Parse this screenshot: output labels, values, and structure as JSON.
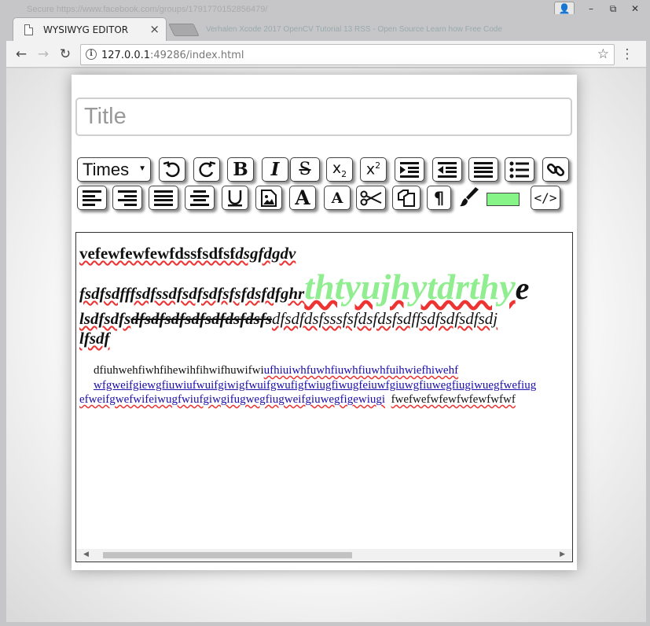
{
  "browser": {
    "ghost_titlebar_text": "Secure   https://www.facebook.com/groups/1791770152856479/",
    "tab_title": "WYSIWYG EDITOR",
    "tab_close": "×",
    "blurred_tabs_text": "Verhalen   Xcode 2017   OpenCV Tutorial 13   RSS - Open Source   Learn how Free Code",
    "url_host": "127.0.0.1",
    "url_path": ":49286/index.html",
    "window_controls": [
      "user-icon",
      "minimize",
      "restore",
      "close"
    ]
  },
  "editor": {
    "title_placeholder": "Title",
    "font_select_value": "Times",
    "toolbar_row1": [
      "undo-icon",
      "redo-icon",
      "bold-icon",
      "italic-icon",
      "strikethrough-icon",
      "subscript-icon",
      "superscript-icon",
      "indent-icon",
      "outdent-icon",
      "ordered-list-icon",
      "unordered-list-icon",
      "link-icon"
    ],
    "toolbar_row2": [
      "align-left-icon",
      "align-right-icon",
      "justify-icon",
      "align-center-icon",
      "underline-icon",
      "insert-image-icon",
      "font-size-increase-icon",
      "font-size-decrease-icon",
      "cut-icon",
      "copy-icon",
      "paragraph-icon",
      "paint-brush-icon",
      "html-source-icon"
    ],
    "color_swatch": "#86f486",
    "content": {
      "line1_bold": "vefewfewfewfdssfsdfsf",
      "line1_italic": "dsgfdgdv",
      "line2_a": "fsdfsdfffsdfssdfsdfsdfsfsfdsfdfghr",
      "line2_green": "thtyujhytdrthy",
      "line2_big": "e",
      "line3_a": "lsdfsdfs",
      "line3_strike": "dfsdfsdfsdfsdfdsfdsfs",
      "line3_b": "dfsdfdsfsssfsfdsfdsfsdffsdfsdfsdfsdj",
      "line4": "lfsdf",
      "para_plain": "dfiuhwehfiwhfihewihfihwifhuwifwi",
      "para_link1": "ufhiuiwhfuwhfiuwhfiuwhfuihwiefhiwehf",
      "para_link2": "wfgweifgiewgfiuwiufwuifgiwigfwuifgwufigfwiugfiwugfeiuwfgiuwgfiuwegfiugiwuegfwefiug",
      "para_link3": "efweifgwefwifeiwugfwiufgiwgifugwegfiugweifgiuwegfigewiugi",
      "para_tail": "fwefwefwfewfwfewfwfwf",
      "green_color": "#90ee90",
      "link_color": "#1a0dab"
    }
  }
}
